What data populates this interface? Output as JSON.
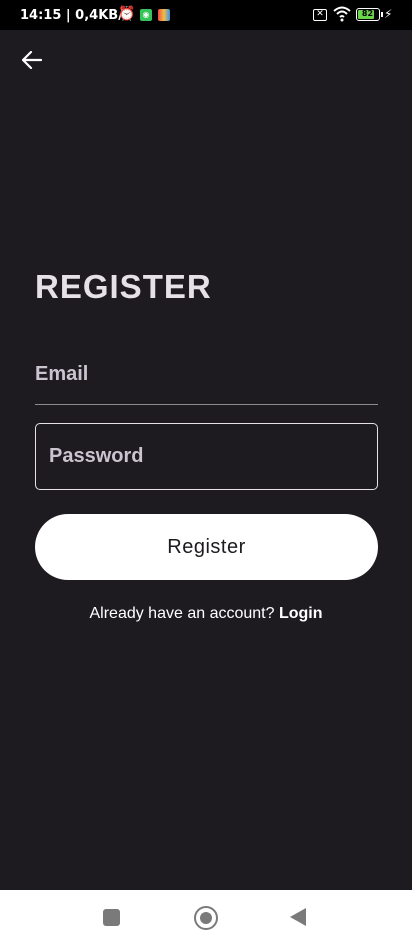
{
  "status_bar": {
    "time": "14:15 | 0,4KB/s",
    "battery_level": "82",
    "icons": [
      "alarm-icon",
      "app-notification-icon",
      "app-notification-icon",
      "sim-off-icon",
      "wifi-icon",
      "battery-icon",
      "charging-icon"
    ]
  },
  "header": {
    "back_icon": "arrow-left-icon"
  },
  "form": {
    "title": "REGISTER",
    "email_placeholder": "Email",
    "email_value": "",
    "password_placeholder": "Password",
    "password_value": "",
    "register_label": "Register",
    "login_prompt": "Already have an account?",
    "login_link": "Login"
  },
  "colors": {
    "background": "#1d1b20",
    "button": "#ffffff",
    "text": "#e6e0e9"
  }
}
